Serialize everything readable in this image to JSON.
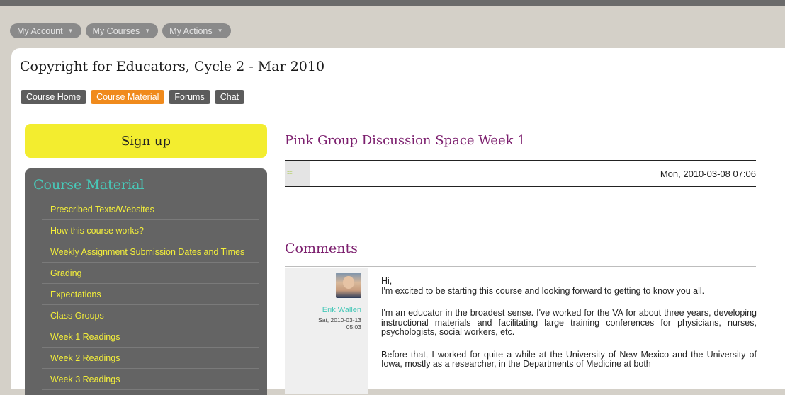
{
  "topbar": {
    "items": [
      {
        "label": "My Account"
      },
      {
        "label": "My Courses"
      },
      {
        "label": "My Actions"
      }
    ]
  },
  "course": {
    "title": "Copyright for Educators, Cycle 2 - Mar 2010"
  },
  "tabs": [
    {
      "label": "Course Home",
      "active": false
    },
    {
      "label": "Course Material",
      "active": true
    },
    {
      "label": "Forums",
      "active": false
    },
    {
      "label": "Chat",
      "active": false
    }
  ],
  "signup": {
    "label": "Sign up"
  },
  "sidebar": {
    "title": "Course Material",
    "items": [
      {
        "label": "Prescribed Texts/Websites"
      },
      {
        "label": "How this course works?"
      },
      {
        "label": "Weekly Assignment Submission Dates and Times"
      },
      {
        "label": "Grading"
      },
      {
        "label": "Expectations"
      },
      {
        "label": "Class Groups"
      },
      {
        "label": "Week 1 Readings"
      },
      {
        "label": "Week 2 Readings"
      },
      {
        "label": "Week 3 Readings"
      }
    ]
  },
  "post": {
    "title": "Pink Group Discussion Space Week 1",
    "date": "Mon, 2010-03-08 07:06",
    "thumb_text": "::::::"
  },
  "comments": {
    "title": "Comments",
    "items": [
      {
        "author": "Erik Wallen",
        "date_line1": "Sat, 2010-03-13",
        "date_line2": "05:03",
        "paragraphs": [
          "Hi,\nI'm excited to be starting this course and looking forward to getting to know you all.",
          "I'm an educator in the broadest sense. I've worked for the VA for about three years, developing instructional materials and facilitating large training conferences for physicians, nurses, psychologists, social workers, etc.",
          "Before that, I worked for quite a while at the University of New Mexico and the University of Iowa, mostly as a researcher, in the Departments of Medicine at both"
        ]
      }
    ]
  },
  "colors": {
    "accent_orange": "#f08a1c",
    "signup_yellow": "#f3ed2f",
    "sidebar_bg": "#646464",
    "teal": "#48c8b8",
    "purple": "#7c1f6e"
  }
}
